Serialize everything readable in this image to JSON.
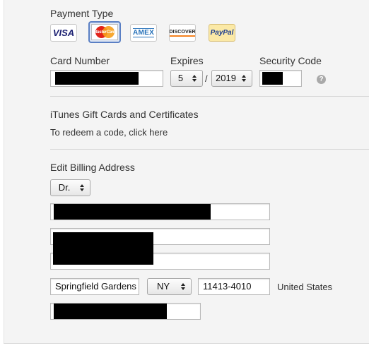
{
  "payment": {
    "title": "Payment Type",
    "cards": [
      {
        "name": "VISA",
        "selected": false
      },
      {
        "name": "MasterCard",
        "selected": true
      },
      {
        "name": "AMEX",
        "selected": false
      },
      {
        "name": "DISCOVER",
        "selected": false
      },
      {
        "name": "PayPal",
        "selected": false
      }
    ]
  },
  "card_details": {
    "card_number_label": "Card Number",
    "expires_label": "Expires",
    "expires_month": "5",
    "expires_separator": "/",
    "expires_year": "2019",
    "security_code_label": "Security Code",
    "help_glyph": "?"
  },
  "gift_cards": {
    "title": "iTunes Gift Cards and Certificates",
    "redeem_text": "To redeem a code, click here"
  },
  "billing": {
    "title": "Edit Billing Address",
    "salutation": "Dr.",
    "city": "Springfield Gardens",
    "state": "NY",
    "zip": "11413-4010",
    "country": "United States"
  },
  "colors": {
    "panel_bg": "#f4f4f4",
    "selected_border": "#5a7fc4",
    "redaction": "#000000"
  }
}
